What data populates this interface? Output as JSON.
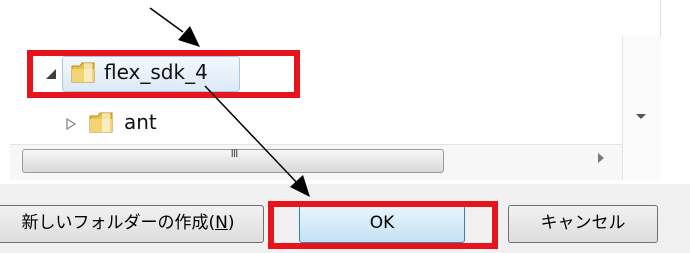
{
  "tree": {
    "items": [
      {
        "label": "flex_sdk_4",
        "expanded": true,
        "selected": true
      },
      {
        "label": "ant",
        "expanded": false,
        "selected": false
      }
    ]
  },
  "scrollbar": {
    "grip": "III"
  },
  "buttons": {
    "new_folder_label": "新しいフォルダーの作成",
    "new_folder_accel": "N",
    "ok_label": "OK",
    "cancel_label": "キャンセル"
  },
  "colors": {
    "callout": "#e8141c",
    "selection": "#dce9f7",
    "ok_accent": "#3c7fb1",
    "folder": "#e8c04a"
  },
  "icons": [
    "expanded-triangle-icon",
    "collapsed-triangle-icon",
    "folder-icon",
    "scroll-down-icon",
    "scroll-right-icon"
  ]
}
